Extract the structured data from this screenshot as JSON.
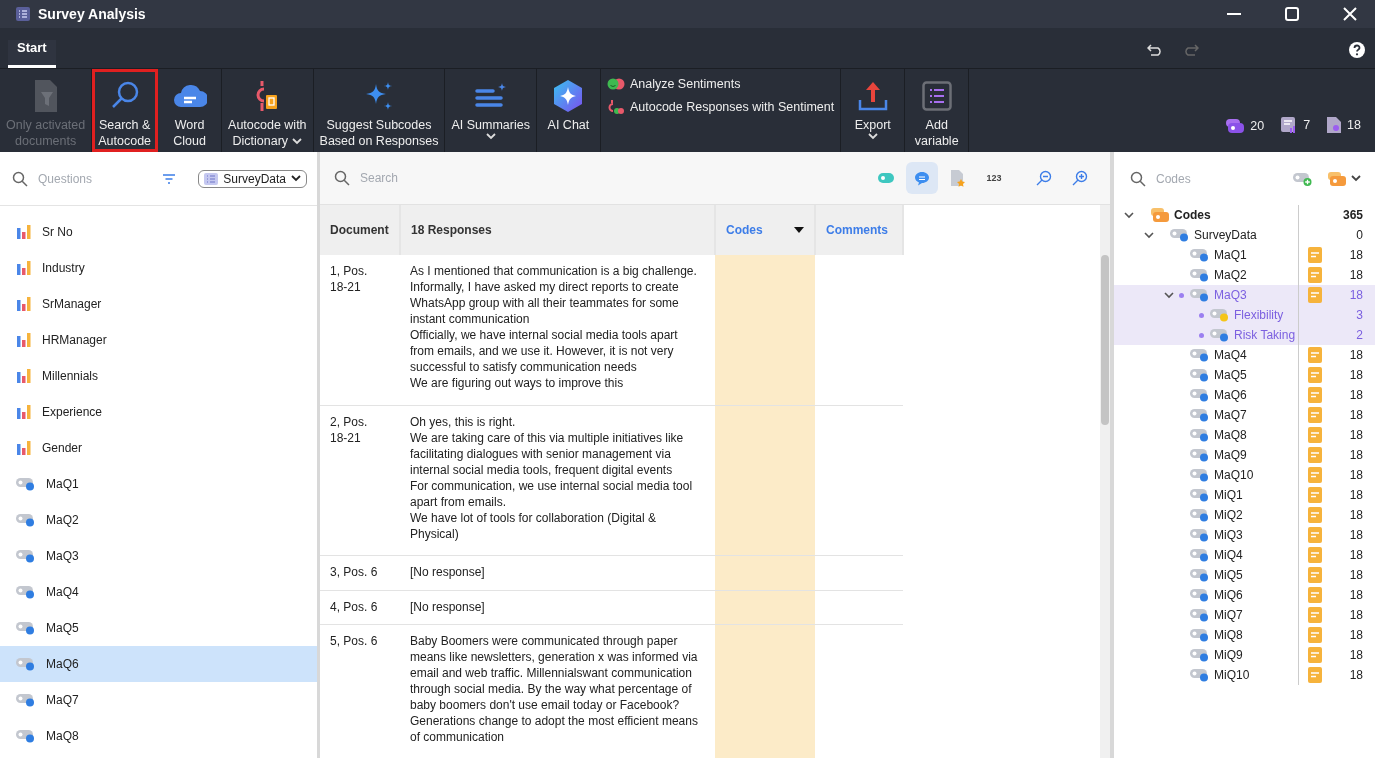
{
  "window": {
    "title": "Survey Analysis"
  },
  "tabs": [
    {
      "label": "Start",
      "selected": true
    }
  ],
  "ribbon": [
    {
      "kind": "filter",
      "lines": [
        "Only activated",
        "documents"
      ],
      "disabled": true,
      "highlighted": false,
      "dropdown": false
    },
    {
      "kind": "search",
      "lines": [
        "Search &",
        "Autocode"
      ],
      "disabled": false,
      "highlighted": true,
      "dropdown": false
    },
    {
      "kind": "cloud",
      "lines": [
        "Word",
        "Cloud"
      ],
      "disabled": false,
      "highlighted": false,
      "dropdown": false
    },
    {
      "kind": "dictionary",
      "lines": [
        "Autocode with",
        "Dictionary"
      ],
      "disabled": false,
      "highlighted": false,
      "dropdown": true
    },
    {
      "kind": "sparkle",
      "lines": [
        "Suggest Subcodes",
        "Based on Responses"
      ],
      "disabled": false,
      "highlighted": false,
      "dropdown": false
    },
    {
      "kind": "summaries",
      "lines": [
        "AI Summaries"
      ],
      "disabled": false,
      "highlighted": false,
      "dropdown": true
    },
    {
      "kind": "chat",
      "lines": [
        "AI Chat"
      ],
      "disabled": false,
      "highlighted": false,
      "dropdown": false
    },
    {
      "kind": "stack",
      "items": [
        {
          "kind": "sentiment",
          "label": "Analyze Sentiments"
        },
        {
          "kind": "autosentiment",
          "label": "Autocode Responses with Sentiment"
        }
      ]
    },
    {
      "kind": "export",
      "lines": [
        "Export"
      ],
      "disabled": false,
      "highlighted": false,
      "dropdown": true
    },
    {
      "kind": "variable",
      "lines": [
        "Add",
        "variable"
      ],
      "disabled": false,
      "highlighted": false,
      "dropdown": false
    }
  ],
  "counters": [
    {
      "kind": "codes",
      "value": "20"
    },
    {
      "kind": "memos",
      "value": "7"
    },
    {
      "kind": "documents",
      "value": "18"
    }
  ],
  "questions": {
    "placeholder": "Questions",
    "source": "SurveyData",
    "items": [
      {
        "kind": "variable",
        "label": "Sr No",
        "selected": false
      },
      {
        "kind": "variable",
        "label": "Industry",
        "selected": false
      },
      {
        "kind": "variable",
        "label": "SrManager",
        "selected": false
      },
      {
        "kind": "variable",
        "label": "HRManager",
        "selected": false
      },
      {
        "kind": "variable",
        "label": "Millennials",
        "selected": false
      },
      {
        "kind": "variable",
        "label": "Experience",
        "selected": false
      },
      {
        "kind": "variable",
        "label": "Gender",
        "selected": false
      },
      {
        "kind": "code",
        "label": "MaQ1",
        "selected": false
      },
      {
        "kind": "code",
        "label": "MaQ2",
        "selected": false
      },
      {
        "kind": "code",
        "label": "MaQ3",
        "selected": false
      },
      {
        "kind": "code",
        "label": "MaQ4",
        "selected": false
      },
      {
        "kind": "code",
        "label": "MaQ5",
        "selected": false
      },
      {
        "kind": "code",
        "label": "MaQ6",
        "selected": true
      },
      {
        "kind": "code",
        "label": "MaQ7",
        "selected": false
      },
      {
        "kind": "code",
        "label": "MaQ8",
        "selected": false
      }
    ]
  },
  "responses": {
    "search_placeholder": "Search",
    "tools": [
      {
        "kind": "code",
        "selected": false
      },
      {
        "kind": "comment",
        "selected": true
      },
      {
        "kind": "doc",
        "selected": false
      },
      {
        "kind": "number",
        "label": "123",
        "selected": false
      },
      {
        "kind": "zoomout",
        "selected": false
      },
      {
        "kind": "zoomin",
        "selected": false
      }
    ],
    "columns": [
      "Document",
      "18 Responses",
      "Codes",
      "Comments"
    ],
    "rows": [
      {
        "document": "1, Pos. 18-21",
        "paragraphs": [
          "As I mentioned that communication is a big challenge.",
          "Informally, I have asked my direct reports to create WhatsApp group with all their teammates for some instant communication",
          "Officially, we have internal social media tools apart from emails, and we use it. However, it is not very successful to satisfy communication needs",
          "We are figuring out ways to improve this"
        ]
      },
      {
        "document": "2, Pos. 18-21",
        "paragraphs": [
          "Oh yes, this is right.",
          "We are taking care of this via multiple initiatives like facilitating dialogues with senior management via internal social media tools, frequent digital events",
          "For communication, we use internal social media tool apart from emails.",
          "We have lot of tools for collaboration (Digital & Physical)"
        ]
      },
      {
        "document": "3, Pos. 6",
        "paragraphs": [
          "[No response]"
        ]
      },
      {
        "document": "4, Pos. 6",
        "paragraphs": [
          "[No response]"
        ]
      },
      {
        "document": "5, Pos. 6",
        "paragraphs": [
          "Baby Boomers were communicated through paper means like newsletters, generation x was informed via email and web traffic. Millennialswant communication through social media. By the way what percentage of baby boomers don't use email today or Facebook? Generations change to adopt the most efficient means of communication"
        ]
      }
    ]
  },
  "codes": {
    "placeholder": "Codes",
    "tree": [
      {
        "label": "Codes",
        "count": "365",
        "kind": "root",
        "expanded": true,
        "selected": false,
        "children": [
          {
            "label": "SurveyData",
            "count": "0",
            "kind": "code",
            "color": "#2f7de1",
            "expanded": true,
            "selected": false,
            "children": [
              {
                "label": "MaQ1",
                "count": "18",
                "kind": "code",
                "color": "#2f7de1",
                "selected": false,
                "memo": true
              },
              {
                "label": "MaQ2",
                "count": "18",
                "kind": "code",
                "color": "#2f7de1",
                "selected": false,
                "memo": true
              },
              {
                "label": "MaQ3",
                "count": "18",
                "kind": "code",
                "color": "#2f7de1",
                "expanded": true,
                "selected": true,
                "memo": true,
                "children": [
                  {
                    "label": "Flexibility",
                    "count": "3",
                    "kind": "code",
                    "color": "#f5c518",
                    "selected": true
                  },
                  {
                    "label": "Risk Taking",
                    "count": "2",
                    "kind": "code",
                    "color": "#2f7de1",
                    "selected": true
                  }
                ]
              },
              {
                "label": "MaQ4",
                "count": "18",
                "kind": "code",
                "color": "#2f7de1",
                "selected": false,
                "memo": true
              },
              {
                "label": "MaQ5",
                "count": "18",
                "kind": "code",
                "color": "#2f7de1",
                "selected": false,
                "memo": true
              },
              {
                "label": "MaQ6",
                "count": "18",
                "kind": "code",
                "color": "#2f7de1",
                "selected": false,
                "memo": true
              },
              {
                "label": "MaQ7",
                "count": "18",
                "kind": "code",
                "color": "#2f7de1",
                "selected": false,
                "memo": true
              },
              {
                "label": "MaQ8",
                "count": "18",
                "kind": "code",
                "color": "#2f7de1",
                "selected": false,
                "memo": true
              },
              {
                "label": "MaQ9",
                "count": "18",
                "kind": "code",
                "color": "#2f7de1",
                "selected": false,
                "memo": true
              },
              {
                "label": "MaQ10",
                "count": "18",
                "kind": "code",
                "color": "#2f7de1",
                "selected": false,
                "memo": true
              },
              {
                "label": "MiQ1",
                "count": "18",
                "kind": "code",
                "color": "#2f7de1",
                "selected": false,
                "memo": true
              },
              {
                "label": "MiQ2",
                "count": "18",
                "kind": "code",
                "color": "#2f7de1",
                "selected": false,
                "memo": true
              },
              {
                "label": "MiQ3",
                "count": "18",
                "kind": "code",
                "color": "#2f7de1",
                "selected": false,
                "memo": true
              },
              {
                "label": "MiQ4",
                "count": "18",
                "kind": "code",
                "color": "#2f7de1",
                "selected": false,
                "memo": true
              },
              {
                "label": "MiQ5",
                "count": "18",
                "kind": "code",
                "color": "#2f7de1",
                "selected": false,
                "memo": true
              },
              {
                "label": "MiQ6",
                "count": "18",
                "kind": "code",
                "color": "#2f7de1",
                "selected": false,
                "memo": true
              },
              {
                "label": "MiQ7",
                "count": "18",
                "kind": "code",
                "color": "#2f7de1",
                "selected": false,
                "memo": true
              },
              {
                "label": "MiQ8",
                "count": "18",
                "kind": "code",
                "color": "#2f7de1",
                "selected": false,
                "memo": true
              },
              {
                "label": "MiQ9",
                "count": "18",
                "kind": "code",
                "color": "#2f7de1",
                "selected": false,
                "memo": true
              },
              {
                "label": "MiQ10",
                "count": "18",
                "kind": "code",
                "color": "#2f7de1",
                "selected": false,
                "memo": true
              }
            ]
          }
        ]
      }
    ]
  }
}
